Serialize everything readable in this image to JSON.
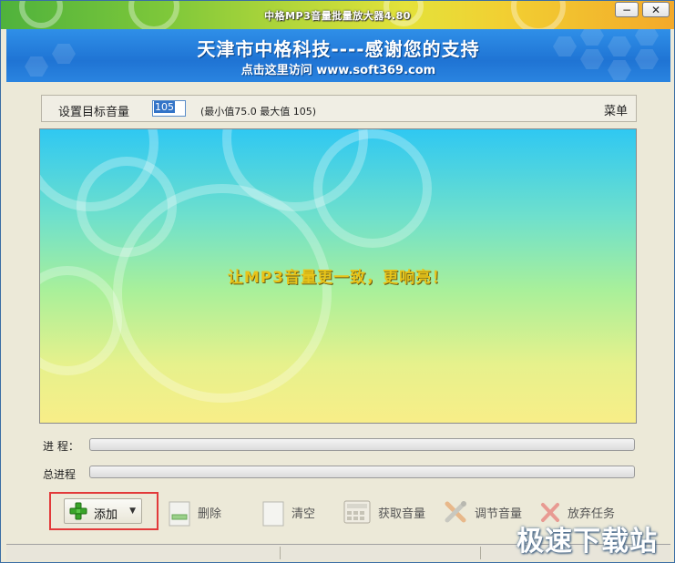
{
  "window": {
    "title": "中格MP3音量批量放大器4.80",
    "minimize_label": "−",
    "close_label": "✕"
  },
  "banner": {
    "title": "天津市中格科技----感谢您的支持",
    "link": "点击这里访问 www.soft369.com"
  },
  "settings": {
    "label": "设置目标音量",
    "volume_value": "105",
    "range_text": "(最小值75.0  最大值 105)",
    "menu_label": "菜单"
  },
  "main": {
    "slogan": "让MP3音量更一致，更响亮！"
  },
  "progress": {
    "item_label": "进  程：",
    "item_value": 0,
    "total_label": "总进程",
    "total_value": 0
  },
  "toolbar": {
    "add": "添加",
    "delete": "删除",
    "clear": "清空",
    "get_volume": "获取音量",
    "adjust_volume": "调节音量",
    "abort": "放弃任务"
  },
  "watermark": "极速下载站",
  "colors": {
    "banner": "#1f74d4",
    "highlight_border": "#e23a3a",
    "slogan": "#e8c41a"
  },
  "icons": {
    "add": "green-plus-icon",
    "delete": "minus-icon",
    "clear": "blank-page-icon",
    "get_volume": "calculator-icon",
    "adjust_volume": "tools-icon",
    "abort": "red-x-icon"
  }
}
